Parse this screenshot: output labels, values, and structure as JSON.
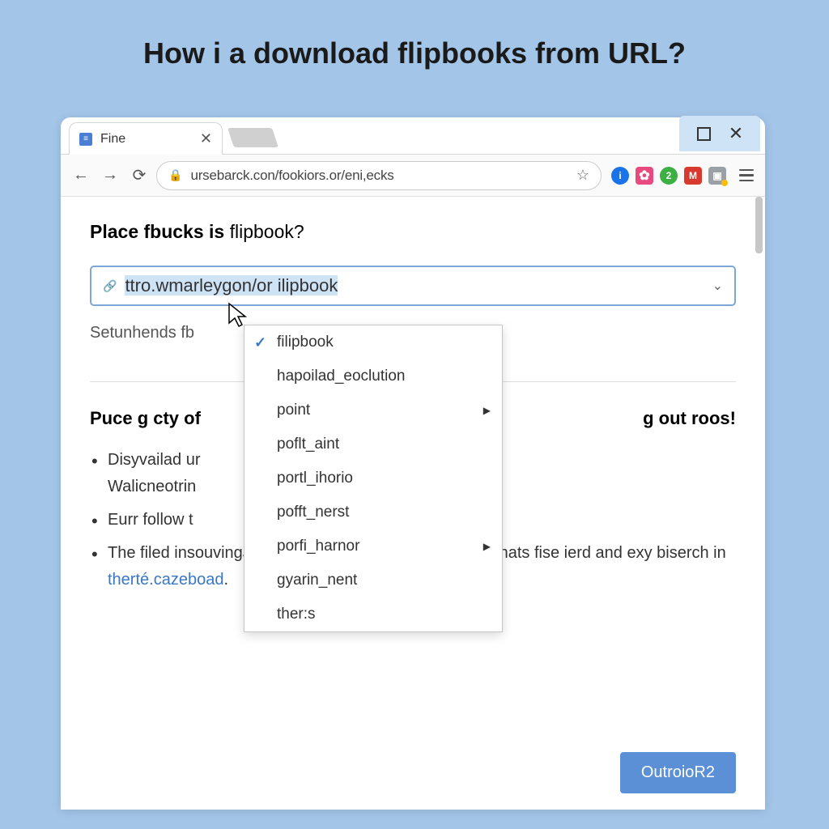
{
  "page_title": "How i a download flipbooks from URL?",
  "window": {
    "tab_title": "Fine",
    "url": "ursebarck.con/fookiors.or/eni,ecks"
  },
  "extensions": {
    "blue": "i",
    "pink": "✿",
    "green": "2",
    "red": "M",
    "grey": "▣"
  },
  "content": {
    "heading_bold": "Place fbucks is",
    "heading_light": " flipbook?",
    "url_field_value": "ttro.wmarleygon/or ilipbook",
    "sub_label": "Setunhends fb",
    "section_title_left": "Puce g cty of",
    "section_title_right": "g out roos!",
    "bullets": [
      {
        "line1": "Disyvailad ur",
        "line2": "Walicneotrin"
      },
      {
        "line1": "Eurr follow t"
      },
      {
        "line1": "The filed insouvingJoumes on, pivmined reelSitS sealchats fise ierd and exy biserch in ",
        "link": "therté.cazeboad",
        "suffix": "."
      }
    ],
    "cta_label": "OutroioR2"
  },
  "dropdown": {
    "items": [
      {
        "label": "filipbook",
        "selected": true,
        "submenu": false
      },
      {
        "label": "hapoilad_eoclution",
        "selected": false,
        "submenu": false
      },
      {
        "label": "point",
        "selected": false,
        "submenu": true
      },
      {
        "label": "poflt_aint",
        "selected": false,
        "submenu": false
      },
      {
        "label": "portl_ihorio",
        "selected": false,
        "submenu": false
      },
      {
        "label": "pofft_nerst",
        "selected": false,
        "submenu": false
      },
      {
        "label": "porfi_harnor",
        "selected": false,
        "submenu": true
      },
      {
        "label": "gyarin_nent",
        "selected": false,
        "submenu": false
      },
      {
        "label": "ther:s",
        "selected": false,
        "submenu": false
      }
    ]
  }
}
